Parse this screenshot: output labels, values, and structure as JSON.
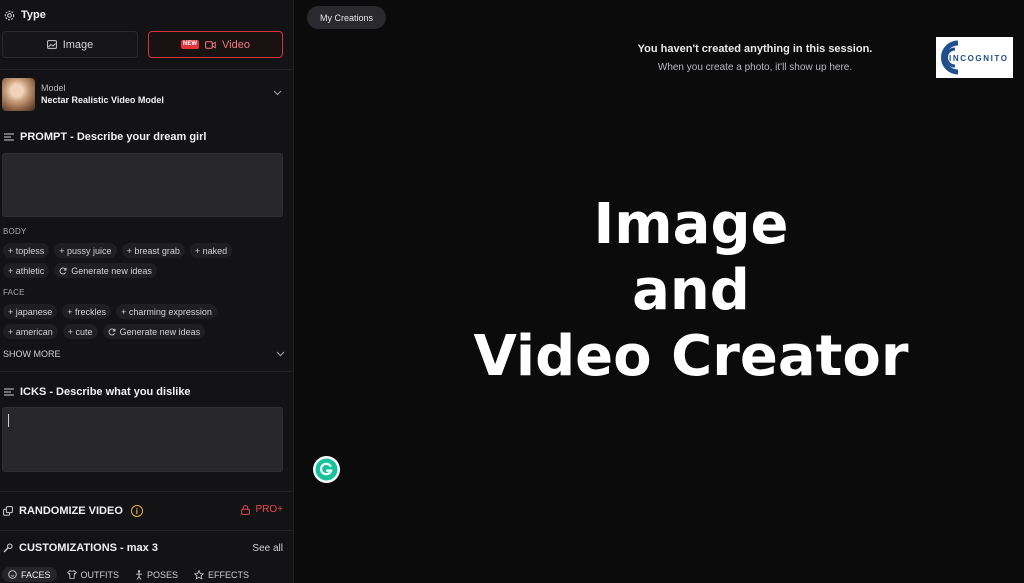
{
  "sidebar": {
    "type_section": {
      "title": "Type",
      "image_label": "Image",
      "video_label": "Video",
      "new_badge": "NEW"
    },
    "model": {
      "caption": "Model",
      "name": "Nectar Realistic Video Model"
    },
    "prompt": {
      "title": "PROMPT - Describe your dream girl",
      "value": ""
    },
    "body": {
      "caption": "BODY",
      "chips": [
        "+ topless",
        "+ pussy juice",
        "+ breast grab",
        "+ naked",
        "+ athletic"
      ],
      "generate_label": "Generate new ideas"
    },
    "face": {
      "caption": "FACE",
      "chips": [
        "+ japanese",
        "+ freckles",
        "+ charming expression",
        "+ american",
        "+ cute"
      ],
      "generate_label": "Generate new ideas"
    },
    "show_more_label": "SHOW MORE",
    "icks": {
      "title": "ICKS - Describe what you dislike",
      "value": ""
    },
    "randomize": {
      "label": "RANDOMIZE VIDEO",
      "info": "i",
      "pro_label": "PRO+"
    },
    "customizations": {
      "title": "CUSTOMIZATIONS - max 3",
      "see_all_label": "See all",
      "tabs": [
        "FACES",
        "OUTFITS",
        "POSES",
        "EFFECTS"
      ],
      "active_tab": "FACES"
    }
  },
  "main": {
    "my_creations_label": "My Creations",
    "empty_title": "You haven't created anything in this session.",
    "empty_subtitle": "When you create a photo, it'll show up here."
  },
  "overlay": {
    "line1": "Image",
    "line2": "and",
    "line3": "Video Creator"
  },
  "logo": {
    "text": "INCOGNITO"
  },
  "colors": {
    "accent_red": "#e0353d",
    "info_yellow": "#e2b737",
    "grammarly_green": "#15c39a",
    "logo_blue": "#1f4f8c"
  },
  "icons": [
    "settings-icon",
    "image-icon",
    "video-camera-icon",
    "chevron-down-icon",
    "lines-icon",
    "refresh-icon",
    "dice-icon",
    "info-icon",
    "lock-icon",
    "wrench-icon",
    "face-icon",
    "shirt-icon",
    "pose-icon",
    "star-icon",
    "grammarly-icon"
  ]
}
